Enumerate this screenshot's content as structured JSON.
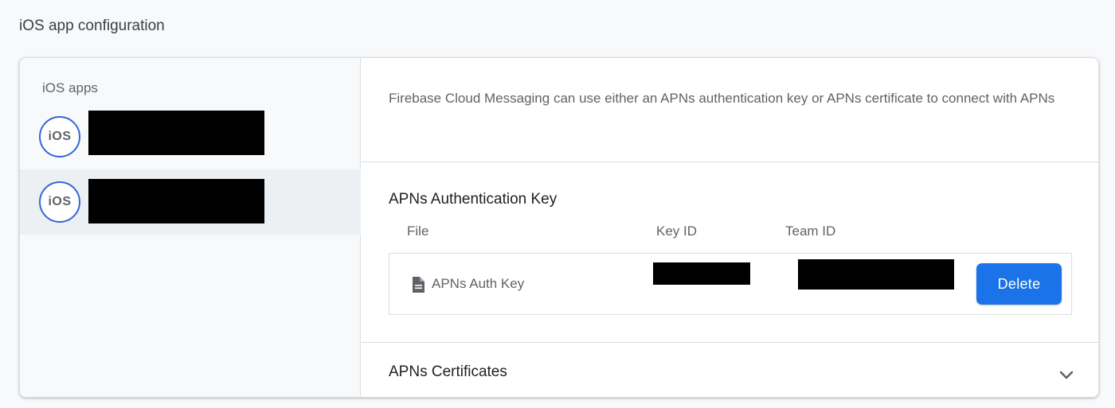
{
  "section": {
    "title": "iOS app configuration"
  },
  "sidebar": {
    "heading": "iOS apps",
    "apps": [
      {
        "badge": "iOS",
        "selected": false
      },
      {
        "badge": "iOS",
        "selected": true
      }
    ]
  },
  "main": {
    "intro": "Firebase Cloud Messaging can use either an APNs authentication key or APNs certificate to connect with APNs",
    "auth_key": {
      "heading": "APNs Authentication Key",
      "columns": {
        "file": "File",
        "key_id": "Key ID",
        "team_id": "Team ID"
      },
      "row": {
        "file_name": "APNs Auth Key",
        "file_icon": "file-icon",
        "delete_label": "Delete"
      }
    },
    "certificates": {
      "title": "APNs Certificates",
      "expand_icon": "chevron-down-icon"
    }
  },
  "colors": {
    "accent": "#1a73e8",
    "badge_ring": "#3367d6",
    "selected_bg": "#edf0f2"
  }
}
